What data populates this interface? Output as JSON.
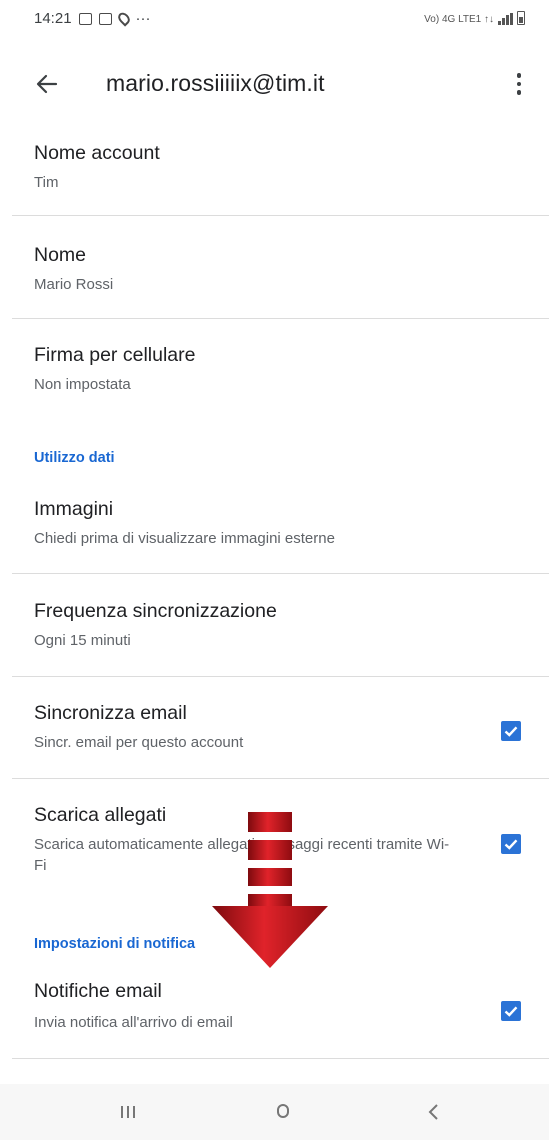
{
  "status_bar": {
    "time": "14:21",
    "dots": "···",
    "network": "Vo) 4G LTE1 ↑↓"
  },
  "app_bar": {
    "title": "mario.rossiiiiix@tim.it"
  },
  "settings": {
    "account_name": {
      "title": "Nome account",
      "subtitle": "Tim"
    },
    "name": {
      "title": "Nome",
      "subtitle": "Mario Rossi"
    },
    "signature": {
      "title": "Firma per cellulare",
      "subtitle": "Non impostata"
    },
    "data_usage_section": "Utilizzo dati",
    "images": {
      "title": "Immagini",
      "subtitle": "Chiedi prima di visualizzare immagini esterne"
    },
    "sync_frequency": {
      "title": "Frequenza sincronizzazione",
      "subtitle": "Ogni 15 minuti"
    },
    "sync_email": {
      "title": "Sincronizza email",
      "subtitle": "Sincr. email per questo account",
      "checked": true
    },
    "download_attachments": {
      "title": "Scarica allegati",
      "subtitle": "Scarica automaticamente allegati messaggi recenti tramite Wi-Fi",
      "checked": true
    },
    "notification_section": "Impostazioni di notifica",
    "email_notifications": {
      "title": "Notifiche email",
      "subtitle": "Invia notifica all'arrivo di email",
      "checked": true
    }
  },
  "colors": {
    "accent": "#1967d2",
    "checkbox": "#2b73d6",
    "arrow": "#c8151b"
  },
  "icons": {
    "back": "arrow-left-icon",
    "overflow": "more-vert-icon",
    "checkbox": "checkbox-checked-icon",
    "nav_recents": "recents-icon",
    "nav_home": "home-icon",
    "nav_back": "chevron-left-icon"
  }
}
